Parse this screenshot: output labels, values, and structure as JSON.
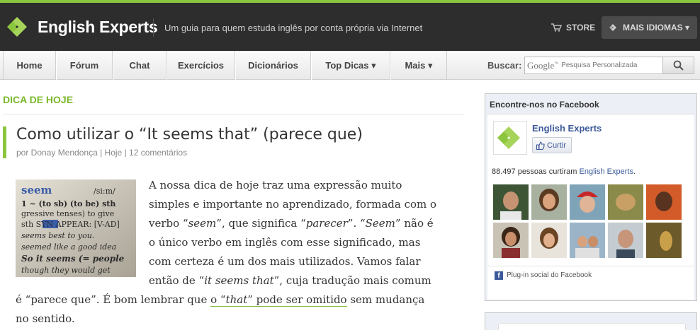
{
  "header": {
    "brand": "English Experts",
    "tagline": "Um guia para quem estuda inglês por conta própria via Internet",
    "store_label": "STORE",
    "mais_idiomas_label": "MAIS IDIOMAS ▾"
  },
  "nav": {
    "items": [
      {
        "label": "Home"
      },
      {
        "label": "Fórum"
      },
      {
        "label": "Chat"
      },
      {
        "label": "Exercícios"
      },
      {
        "label": "Dicionários"
      },
      {
        "label": "Top Dicas ▾"
      },
      {
        "label": "Mais ▾"
      }
    ],
    "search_label": "Buscar:",
    "search_google": "Google",
    "search_placeholder": "Pesquisa Personalizada"
  },
  "post": {
    "section_label": "DICA DE HOJE",
    "title": "Como utilizar o “It seems that” (parece que)",
    "author": "por Donay Mendonça",
    "date": "Hoje",
    "comments": "12 comentários",
    "thumb_words": [
      "seem",
      "/si:m/",
      "1 ~ (to sb) (to be) sth",
      "gressive tenses) to give",
      "sth SYN APPEAR: [V-AD]",
      "seems best to you.",
      "seemed like a good idea",
      "So it seems (= people",
      "though they would get"
    ],
    "p1": "A nossa dica de hoje traz uma expressão muito simples e importante no aprendizado, formada com o verbo “",
    "w_seem": "seem",
    "p2": "”, que significa “",
    "w_parecer": "parecer",
    "p3": "”. “",
    "w_seem2": "Seem",
    "p4": "” não é o único verbo em inglês com esse significado, mas com certeza é um dos mais utilizados. Vamos falar então de “",
    "w_itseemsthat": "it seems that",
    "p5": "”, cuja tradução mais comum é “parece que”. É bom lembrar que ",
    "link_pre": "o “",
    "link_that": "that",
    "link_post": "” pode ser omitido",
    "p6": " sem mudança no sentido."
  },
  "facebook": {
    "heading": "Encontre-nos no Facebook",
    "page_name": "English Experts",
    "like_label": "Curtir",
    "count_text": "88.497 pessoas curtiram ",
    "count_link": "English Experts",
    "count_suffix": ".",
    "footer": "Plug-in social do Facebook"
  },
  "colors": {
    "accent_green": "#8cc63f",
    "header_bg": "#2d2d2d",
    "facebook_blue": "#3b5998"
  }
}
